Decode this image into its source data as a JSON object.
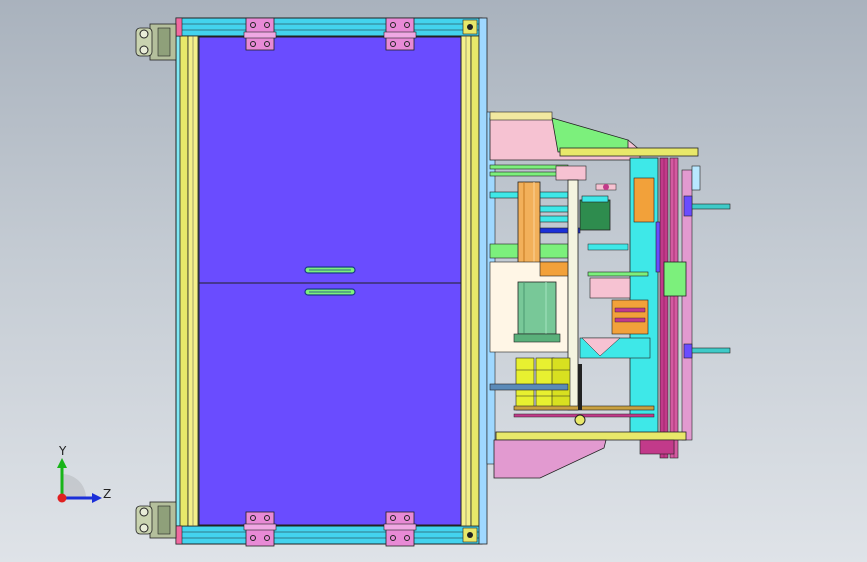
{
  "viewport": {
    "background_top": "#a9b2bd",
    "background_bottom": "#dfe3e8"
  },
  "colors": {
    "panel": "#6a4cff",
    "frame": "#43d3ee",
    "rail_yellow": "#e8e86a",
    "bracket": "#e88ad6",
    "mechanism_green": "#7cf07c",
    "mechanism_pink": "#f6c2d2",
    "mechanism_magenta": "#c23a8a",
    "mechanism_cyan": "#3ee8e8",
    "mechanism_orange": "#f2a13a",
    "axis_x": "#e02020",
    "axis_y": "#18b418",
    "axis_z": "#1a2fd8"
  },
  "triad": {
    "y_label": "Y",
    "z_label": "Z"
  }
}
